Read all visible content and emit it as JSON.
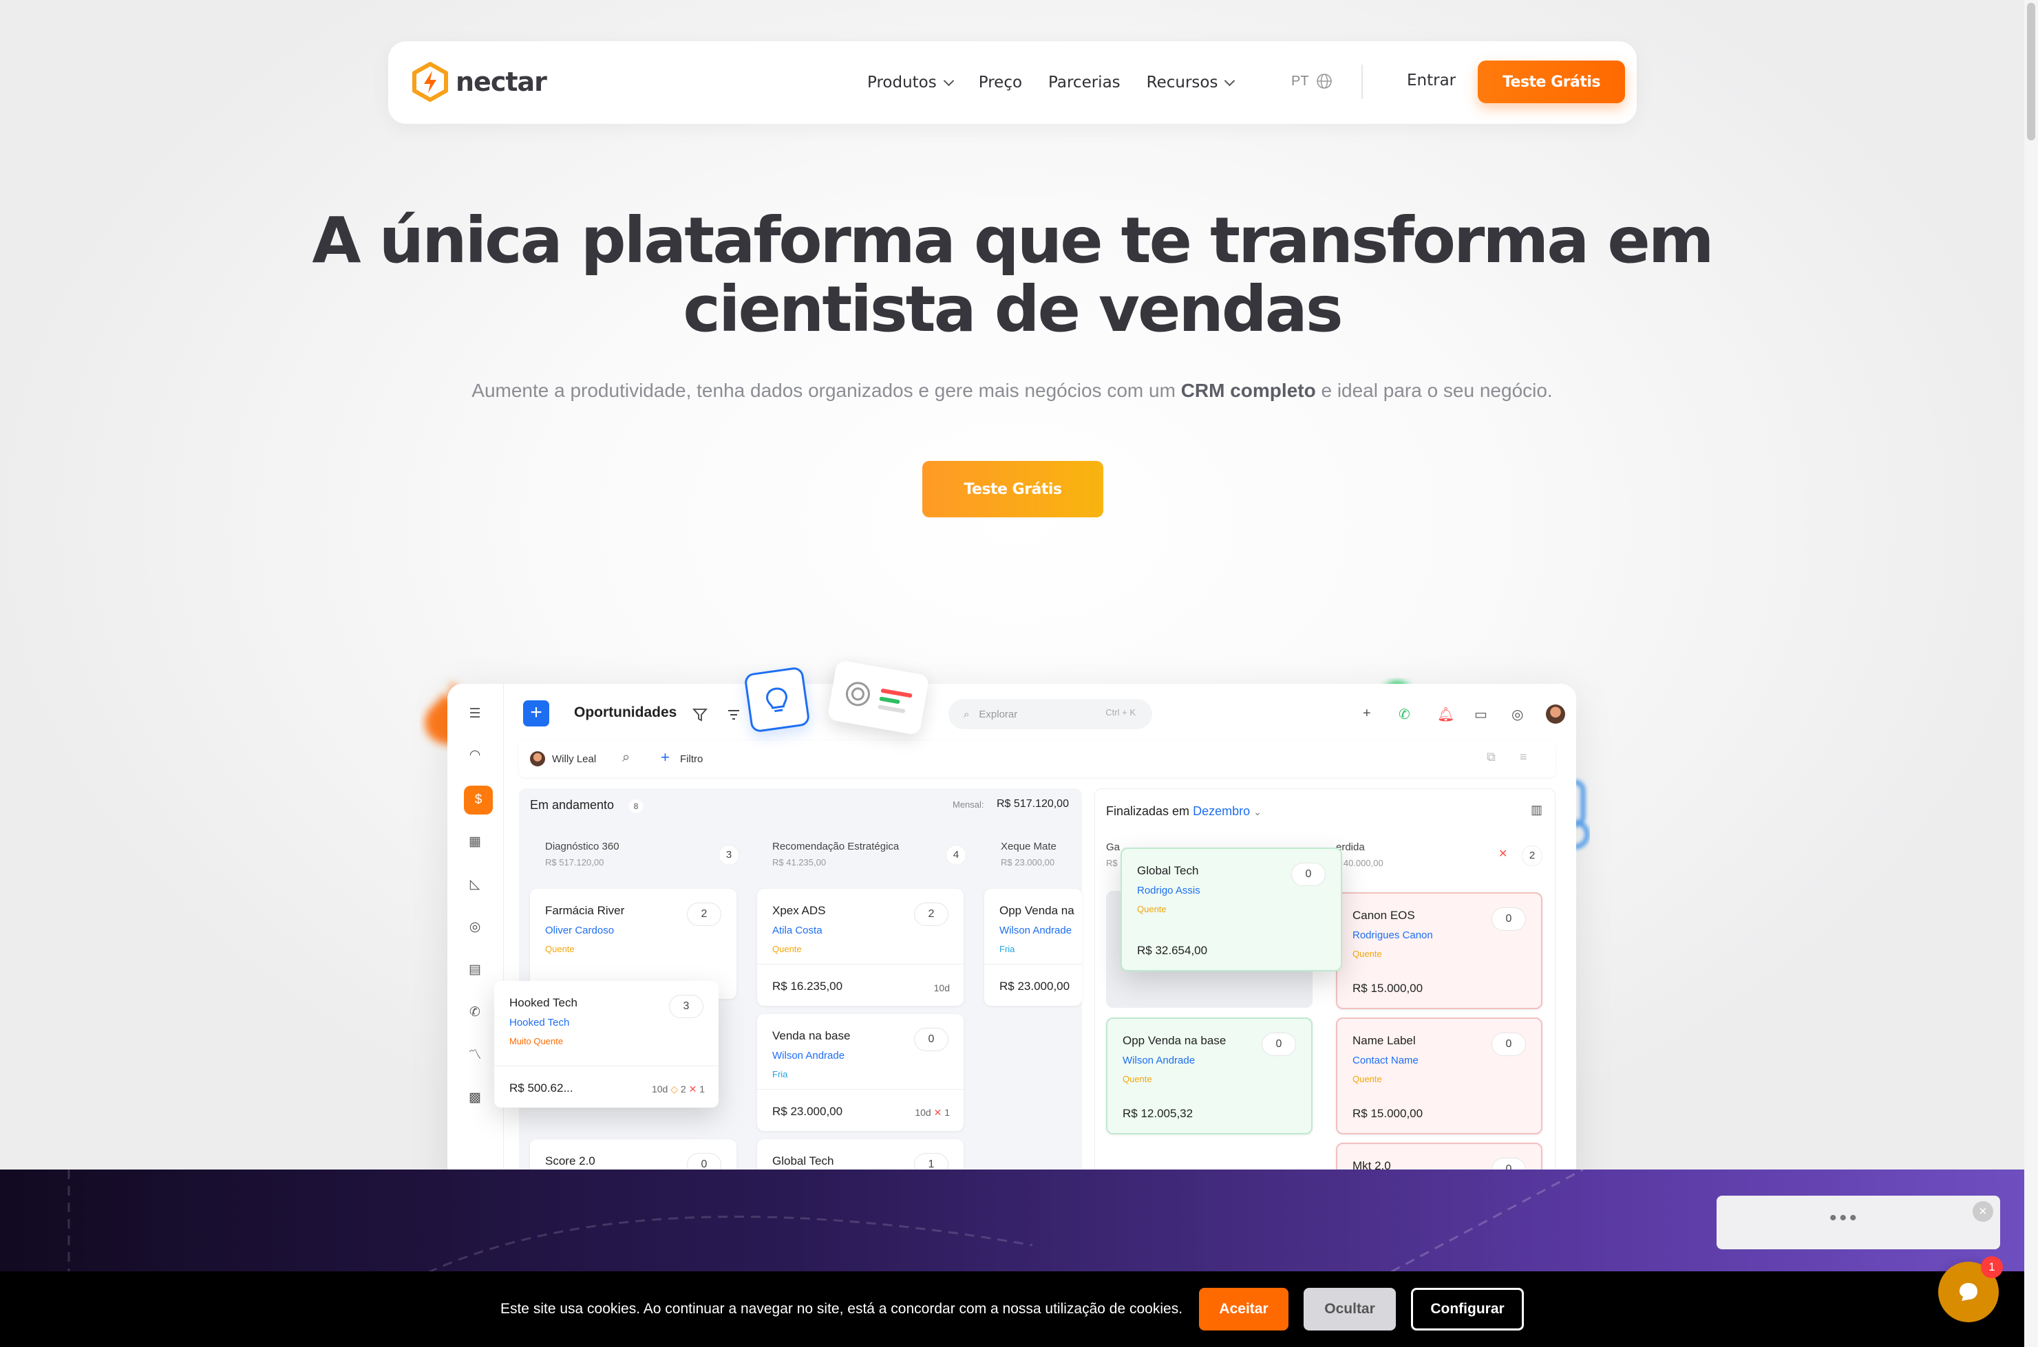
{
  "nav": {
    "logo_text": "nectar",
    "items": [
      {
        "label": "Produtos",
        "dropdown": true
      },
      {
        "label": "Preço",
        "dropdown": false
      },
      {
        "label": "Parcerias",
        "dropdown": false
      },
      {
        "label": "Recursos",
        "dropdown": true
      }
    ],
    "lang": "PT",
    "login": "Entrar",
    "cta": "Teste Grátis"
  },
  "hero": {
    "title_line1": "A única plataforma que te transforma em",
    "title_line2": "cientista de vendas",
    "subtitle_pre": "Aumente a produtividade, tenha dados organizados e gere mais negócios com um ",
    "subtitle_bold": "CRM completo",
    "subtitle_post": " e ideal para o seu negócio.",
    "cta": "Teste Grátis"
  },
  "app": {
    "title": "Oportunidades",
    "search_placeholder": "Explorar",
    "search_shortcut": "Ctrl + K",
    "user": "Willy Leal",
    "filter": "Filtro",
    "in_progress": {
      "label": "Em andamento",
      "count": "8",
      "monthly_label": "Mensal:",
      "monthly_value": "R$ 517.120,00",
      "columns": [
        {
          "name": "Diagnóstico 360",
          "value": "R$ 517.120,00",
          "count": "3"
        },
        {
          "name": "Recomendação Estratégica",
          "value": "R$ 41.235,00",
          "count": "4"
        },
        {
          "name": "Xeque Mate",
          "value": "R$ 23.000,00",
          "count": ""
        }
      ],
      "cards": [
        {
          "title": "Farmácia River",
          "contact": "Oliver Cardoso",
          "tag": "Quente",
          "count": "2"
        },
        {
          "title": "Xpex ADS",
          "contact": "Atila Costa",
          "tag": "Quente",
          "count": "2",
          "value": "R$ 16.235,00",
          "days": "10d"
        },
        {
          "title": "Opp Venda na",
          "contact": "Wilson Andrade",
          "tag": "Fria",
          "value": "R$ 23.000,00"
        },
        {
          "title": "Venda na base",
          "contact": "Wilson Andrade",
          "tag": "Fria",
          "count": "0",
          "value": "R$ 23.000,00",
          "days": "10d",
          "neg": "1"
        },
        {
          "title": "Score 2.0",
          "count": "0"
        },
        {
          "title": "Global Tech",
          "count": "1"
        }
      ],
      "floating_card": {
        "title": "Hooked Tech",
        "contact": "Hooked Tech",
        "tag": "Muito Quente",
        "count": "3",
        "value": "R$ 500.62...",
        "days": "10d",
        "alerts": "2",
        "neg": "1"
      }
    },
    "finished": {
      "label": "Finalizadas em",
      "month": "Dezembro",
      "lost_label": "erdida",
      "lost_value": "$ 40.000,00",
      "lost_count": "2",
      "won_label": "Ga",
      "won_value": "R$",
      "cards": [
        {
          "title": "Global Tech",
          "contact": "Rodrigo Assis",
          "tag": "Quente",
          "count": "0",
          "value": "R$ 32.654,00"
        },
        {
          "title": "Canon EOS",
          "contact": "Rodrigues Canon",
          "tag": "Quente",
          "count": "0",
          "value": "R$ 15.000,00"
        },
        {
          "title": "Opp Venda na base",
          "contact": "Wilson Andrade",
          "tag": "Quente",
          "count": "0",
          "value": "R$ 12.005,32"
        },
        {
          "title": "Name Label",
          "contact": "Contact Name",
          "tag": "Quente",
          "count": "0",
          "value": "R$ 15.000,00"
        },
        {
          "title": "Mkt 2.0",
          "count": "0"
        }
      ]
    }
  },
  "cookie": {
    "text": "Este site usa cookies. Ao continuar a navegar no site, está a concordar com a nossa utilização de cookies.",
    "accept": "Aceitar",
    "hide": "Ocultar",
    "configure": "Configurar"
  },
  "chat": {
    "badge": "1"
  }
}
